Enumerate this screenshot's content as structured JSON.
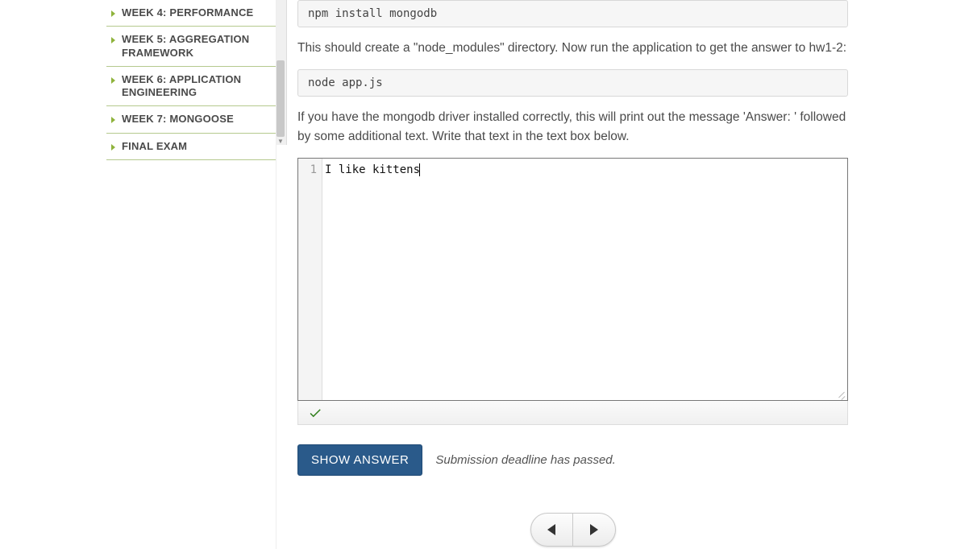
{
  "sidebar": {
    "items": [
      {
        "label": "Week 4: Performance"
      },
      {
        "label": "Week 5: Aggregation Framework"
      },
      {
        "label": "Week 6: Application Engineering"
      },
      {
        "label": "Week 7: Mongoose"
      },
      {
        "label": "Final Exam"
      }
    ]
  },
  "main": {
    "code1": "npm install mongodb",
    "para1": "This should create a \"node_modules\" directory. Now run the application to get the answer to hw1-2:",
    "code2": "node app.js",
    "para2": "If you have the mongodb driver installed correctly, this will print out the message 'Answer: ' followed by some additional text. Write that text in the text box below.",
    "editor": {
      "line_number": "1",
      "value": "I like kittens"
    },
    "button_label": "SHOW ANSWER",
    "deadline_text": "Submission deadline has passed."
  }
}
